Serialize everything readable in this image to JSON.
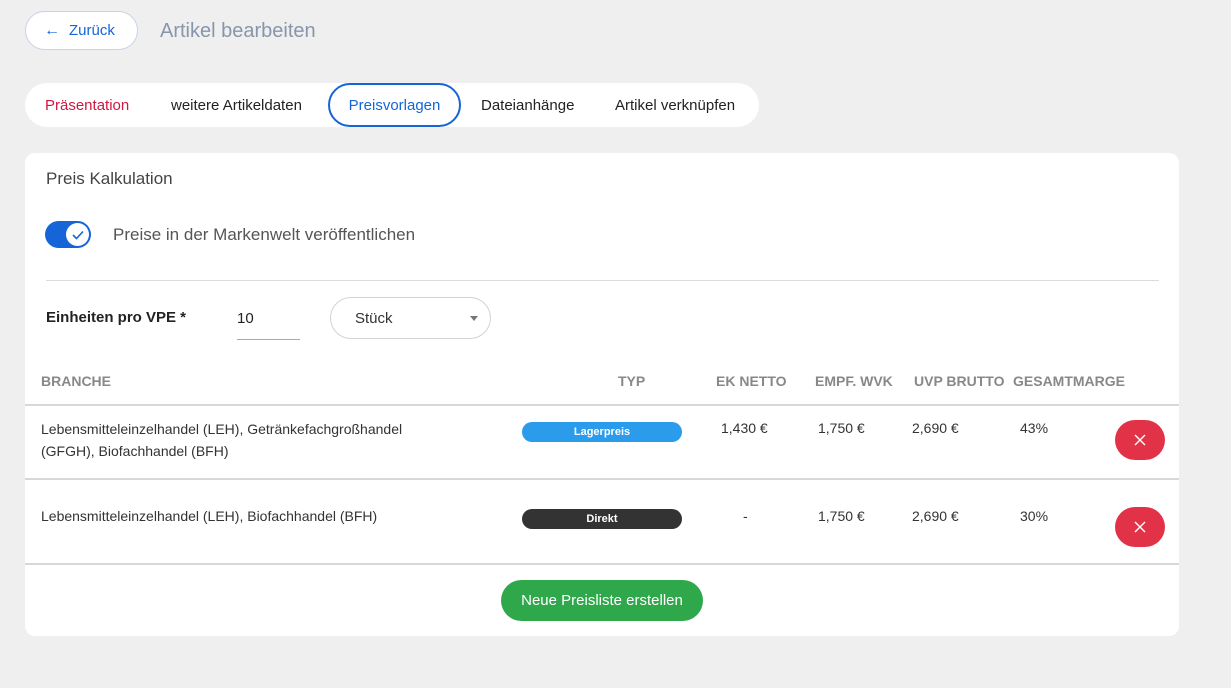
{
  "header": {
    "back_label": "Zurück",
    "title": "Artikel bearbeiten"
  },
  "tabs": [
    {
      "label": "Präsentation"
    },
    {
      "label": "weitere Artikeldaten"
    },
    {
      "label": "Preisvorlagen",
      "active": true
    },
    {
      "label": "Dateianhänge"
    },
    {
      "label": "Artikel verknüpfen"
    }
  ],
  "card": {
    "title": "Preis Kalkulation",
    "publish_toggle": {
      "label": "Preise in der Markenwelt veröffentlichen",
      "on": true
    },
    "vpe": {
      "label": "Einheiten pro VPE *",
      "value": "10"
    },
    "unit": {
      "selected": "Stück"
    },
    "table": {
      "headers": {
        "branche": "BRANCHE",
        "typ": "TYP",
        "ek_netto": "EK NETTO",
        "empf_wvk": "EMPF. WVK",
        "uvp_brutto": "UVP BRUTTO",
        "gesamtmarge": "GESAMTMARGE"
      },
      "rows": [
        {
          "branche": "Lebensmitteleinzelhandel (LEH), Getränkefachgroßhandel (GFGH), Biofachhandel (BFH)",
          "typ": "Lagerpreis",
          "typ_color": "#2b9cec",
          "ek_netto": "1,430 €",
          "empf_wvk": "1,750 €",
          "uvp_brutto": "2,690 €",
          "gesamtmarge": "43%"
        },
        {
          "branche": "Lebensmitteleinzelhandel (LEH), Biofachhandel (BFH)",
          "typ": "Direkt",
          "typ_color": "#333333",
          "ek_netto": "-",
          "empf_wvk": "1,750 €",
          "uvp_brutto": "2,690 €",
          "gesamtmarge": "30%"
        }
      ]
    },
    "new_button_label": "Neue Preisliste erstellen"
  },
  "colors": {
    "accent": "#1565d8",
    "danger": "#e23248",
    "success": "#2ea84a",
    "tab_highlight": "#d0173f"
  }
}
